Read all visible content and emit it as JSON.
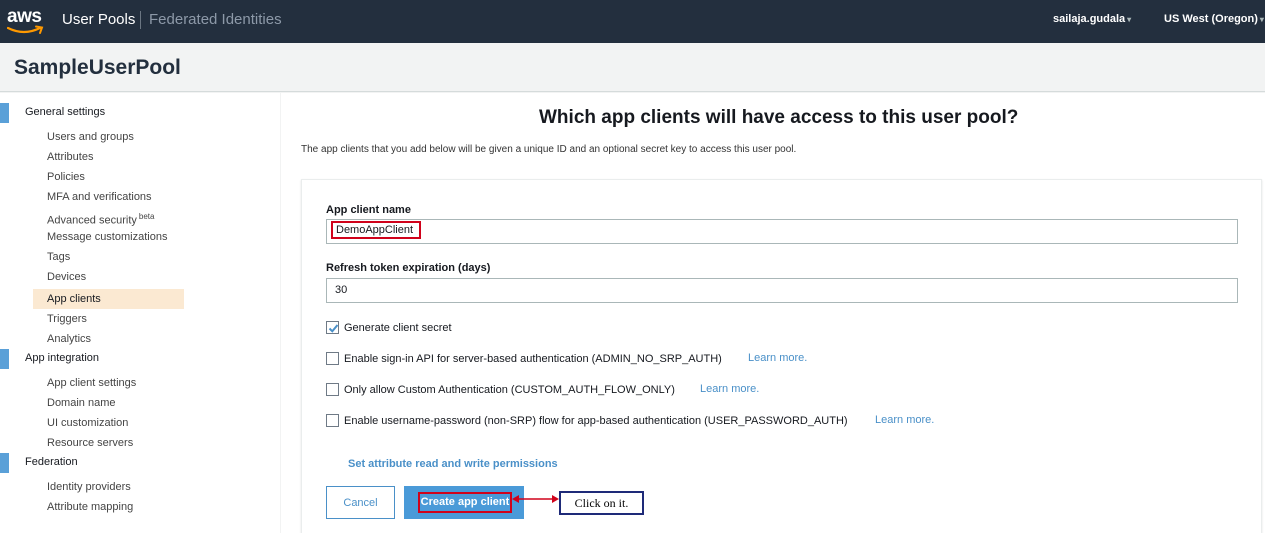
{
  "topnav": {
    "logo": "aws",
    "user_pools": "User Pools",
    "federated_identities": "Federated Identities",
    "user": "sailaja.gudala",
    "region": "US West (Oregon)"
  },
  "page_title": "SampleUserPool",
  "sidebar": {
    "general_settings": "General settings",
    "general_items": [
      "Users and groups",
      "Attributes",
      "Policies",
      "MFA and verifications",
      "Advanced security",
      "Message customizations",
      "Tags",
      "Devices",
      "App clients",
      "Triggers",
      "Analytics"
    ],
    "advanced_security_badge": "beta",
    "app_integration": "App integration",
    "app_items": [
      "App client settings",
      "Domain name",
      "UI customization",
      "Resource servers"
    ],
    "federation": "Federation",
    "federation_items": [
      "Identity providers",
      "Attribute mapping"
    ],
    "active_item": "App clients"
  },
  "main": {
    "heading": "Which app clients will have access to this user pool?",
    "intro": "The app clients that you add below will be given a unique ID and an optional secret key to access this user pool.",
    "client_name_label": "App client name",
    "client_name_value": "DemoAppClient",
    "refresh_label": "Refresh token expiration (days)",
    "refresh_value": "30",
    "options": [
      {
        "label": "Generate client secret",
        "checked": true
      },
      {
        "label": "Enable sign-in API for server-based authentication (ADMIN_NO_SRP_AUTH)",
        "checked": false,
        "link": "Learn more."
      },
      {
        "label": "Only allow Custom Authentication (CUSTOM_AUTH_FLOW_ONLY)",
        "checked": false,
        "link": "Learn more."
      },
      {
        "label": "Enable username-password (non-SRP) flow for app-based authentication (USER_PASSWORD_AUTH)",
        "checked": false,
        "link": "Learn more."
      }
    ],
    "attr_link": "Set attribute read and write permissions",
    "cancel_label": "Cancel",
    "create_label": "Create app client",
    "annotation": "Click on it."
  },
  "colors": {
    "topnav_bg": "#232f3e",
    "accent": "#4a9ad8",
    "link": "#4a90c8",
    "highlight": "#d0021b",
    "active_bg": "#fbe9d2"
  }
}
